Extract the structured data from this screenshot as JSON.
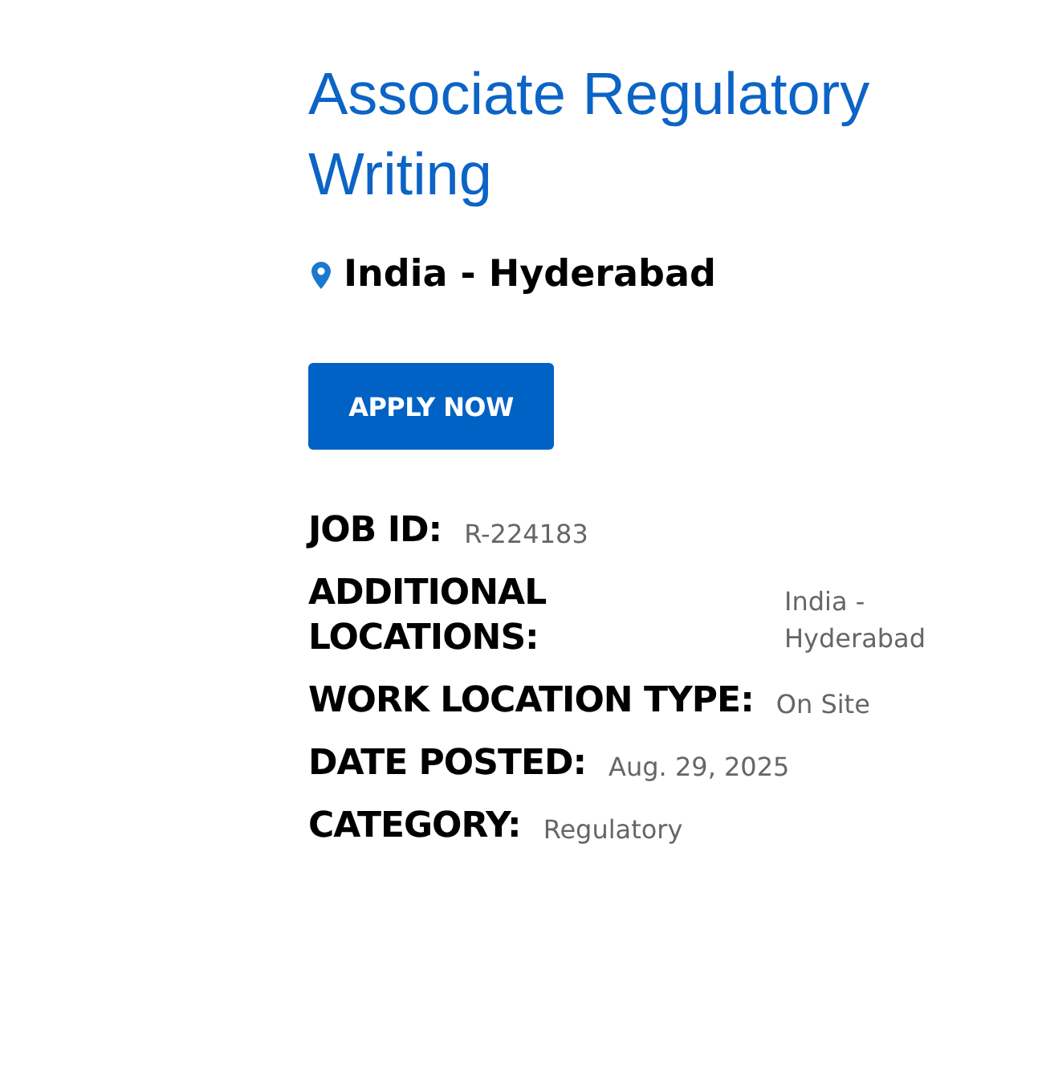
{
  "title": "Associate Regulatory Writing",
  "location": "India - Hyderabad",
  "apply_button": "APPLY NOW",
  "details": [
    {
      "label": "JOB ID:",
      "value": "R-224183"
    },
    {
      "label": "ADDITIONAL LOCATIONS:",
      "value": "India - Hyderabad"
    },
    {
      "label": "WORK LOCATION TYPE:",
      "value": "On Site"
    },
    {
      "label": "DATE POSTED:",
      "value": "Aug. 29, 2025"
    },
    {
      "label": "CATEGORY:",
      "value": "Regulatory"
    }
  ]
}
